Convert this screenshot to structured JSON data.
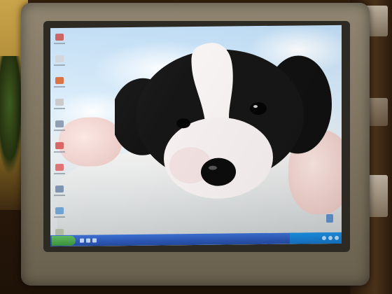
{
  "scene": {
    "subject": "photo-of-crt-monitor-showing-desktop",
    "colors": {
      "monitor_bezel": "#7d7360",
      "sky": "#bfdcf4",
      "taskbar": "#2b56b4",
      "start_button": "#3a8f3a",
      "puppy_black": "#121212",
      "puppy_white": "#f5f2f1"
    }
  },
  "desktop": {
    "icons": [
      "app-icon",
      "app-icon",
      "app-icon",
      "app-icon",
      "app-icon",
      "app-icon",
      "app-icon",
      "app-icon",
      "app-icon",
      "app-icon"
    ],
    "wallpaper": "puppy-wallpaper"
  },
  "taskbar": {
    "start_icon": "start-button-icon",
    "quick_launch_icons": [
      "ie-icon",
      "desktop-icon",
      "media-icon"
    ],
    "tray_icons": [
      "network-icon",
      "volume-icon",
      "security-icon"
    ]
  }
}
